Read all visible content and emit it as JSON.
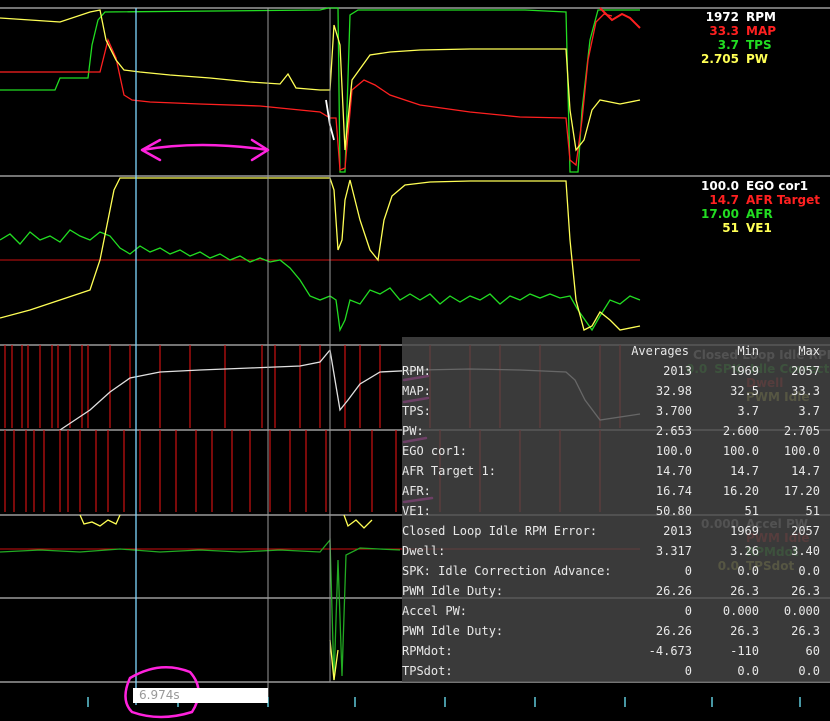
{
  "legends": {
    "graph1": [
      {
        "value": "1972",
        "name": "RPM",
        "color": "#ffffff"
      },
      {
        "value": "33.3",
        "name": "MAP",
        "color": "#ff2020"
      },
      {
        "value": "3.7",
        "name": "TPS",
        "color": "#22dd22"
      },
      {
        "value": "2.705",
        "name": "PW",
        "color": "#ffff55"
      }
    ],
    "graph2": [
      {
        "value": "100.0",
        "name": "EGO cor1",
        "color": "#ffffff"
      },
      {
        "value": "14.7",
        "name": "AFR Target",
        "color": "#ff2020"
      },
      {
        "value": "17.00",
        "name": "AFR",
        "color": "#22dd22"
      },
      {
        "value": "51",
        "name": "VE1",
        "color": "#ffff55"
      }
    ],
    "graph3": [
      {
        "value": "",
        "name": "Closed Loop Idle RPM",
        "color": "#dddddd"
      },
      {
        "value": "0.0",
        "name": "SPK: Idle Correction Advance",
        "color": "#22dd22"
      },
      {
        "value": "",
        "name": "Dwell",
        "color": "#ff2020"
      },
      {
        "value": "",
        "name": "PWM Idle",
        "color": "#ffff55"
      }
    ],
    "graph4": [
      {
        "value": "0.000",
        "name": "Accel PW",
        "color": "#dddddd"
      },
      {
        "value": "",
        "name": "PWM Idle",
        "color": "#ff2020"
      },
      {
        "value": "",
        "name": "RPMdot",
        "color": "#22dd22"
      },
      {
        "value": "0.0",
        "name": "TPSdot",
        "color": "#ffff55"
      }
    ]
  },
  "stats": {
    "headers": [
      "Averages",
      "Min",
      "Max"
    ],
    "rows": [
      {
        "label": "RPM:",
        "avg": "2013",
        "min": "1969",
        "max": "2057"
      },
      {
        "label": "MAP:",
        "avg": "32.98",
        "min": "32.5",
        "max": "33.3"
      },
      {
        "label": "TPS:",
        "avg": "3.700",
        "min": "3.7",
        "max": "3.7"
      },
      {
        "label": "PW:",
        "avg": "2.653",
        "min": "2.600",
        "max": "2.705"
      },
      {
        "label": "EGO cor1:",
        "avg": "100.0",
        "min": "100.0",
        "max": "100.0"
      },
      {
        "label": "AFR Target 1:",
        "avg": "14.70",
        "min": "14.7",
        "max": "14.7"
      },
      {
        "label": "AFR:",
        "avg": "16.74",
        "min": "16.20",
        "max": "17.20"
      },
      {
        "label": "VE1:",
        "avg": "50.80",
        "min": "51",
        "max": "51"
      },
      {
        "label": "Closed Loop Idle RPM Error:",
        "avg": "2013",
        "min": "1969",
        "max": "2057"
      },
      {
        "label": "Dwell:",
        "avg": "3.317",
        "min": "3.26",
        "max": "3.40"
      },
      {
        "label": "SPK: Idle Correction Advance:",
        "avg": "0",
        "min": "0.0",
        "max": "0.0"
      },
      {
        "label": "PWM Idle Duty:",
        "avg": "26.26",
        "min": "26.3",
        "max": "26.3"
      },
      {
        "label": "Accel PW:",
        "avg": "0",
        "min": "0.000",
        "max": "0.000"
      },
      {
        "label": "PWM Idle Duty:",
        "avg": "26.26",
        "min": "26.3",
        "max": "26.3"
      },
      {
        "label": "RPMdot:",
        "avg": "-4.673",
        "min": "-110",
        "max": "60"
      },
      {
        "label": "TPSdot:",
        "avg": "0",
        "min": "0.0",
        "max": "0.0"
      }
    ]
  },
  "time_readout": "6.974s",
  "colors": {
    "grid": "#9a9a9a",
    "cursor": "#7fd6ff",
    "annotation": "#ff22dd"
  }
}
